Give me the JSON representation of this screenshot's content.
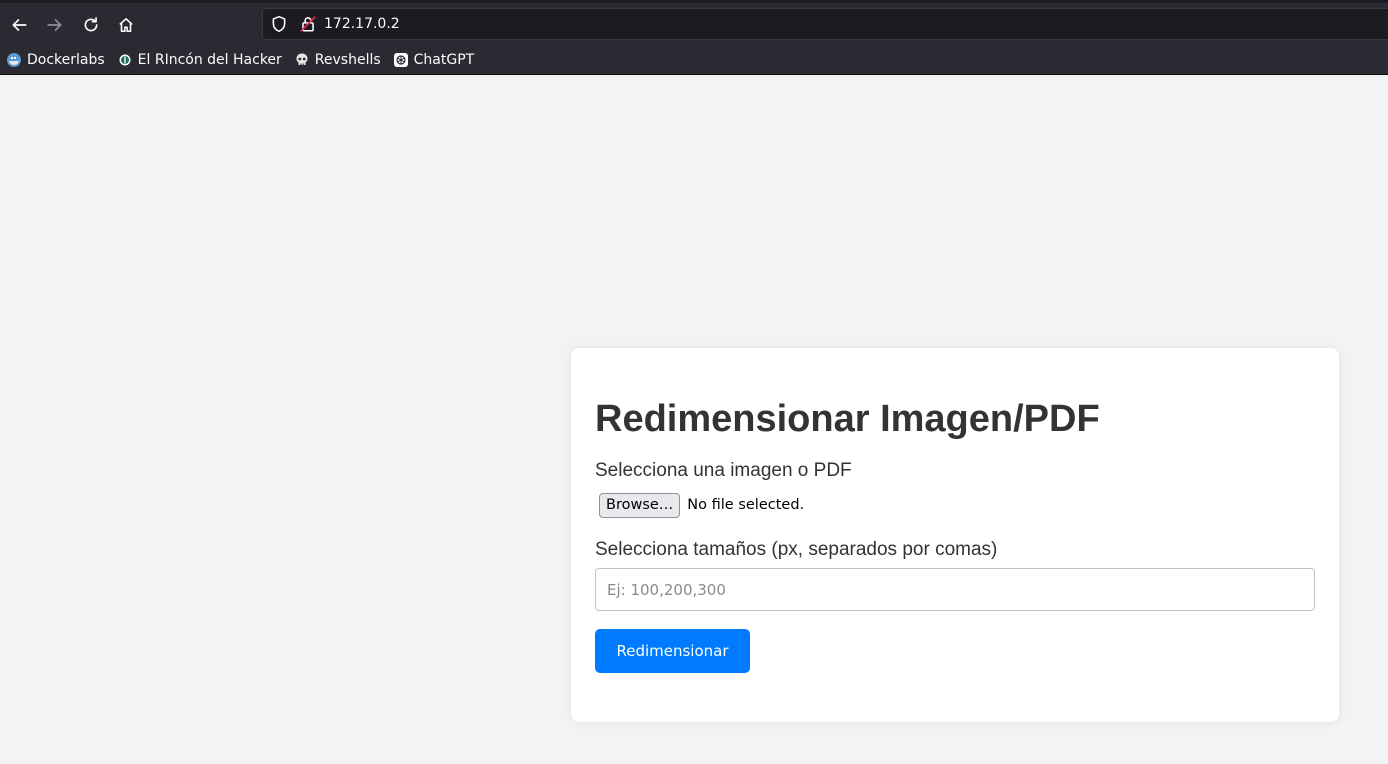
{
  "browser": {
    "url": "172.17.0.2",
    "nav": {
      "back_icon": "arrow-left-icon",
      "forward_icon": "arrow-right-icon",
      "reload_icon": "reload-icon",
      "home_icon": "home-icon"
    },
    "bookmarks": [
      {
        "label": "Dockerlabs",
        "icon": "dockerlabs-favicon"
      },
      {
        "label": "El RIncón del Hacker",
        "icon": "rincon-favicon"
      },
      {
        "label": "Revshells",
        "icon": "skull-favicon"
      },
      {
        "label": "ChatGPT",
        "icon": "chatgpt-favicon"
      }
    ]
  },
  "page": {
    "title": "Redimensionar Imagen/PDF",
    "file_label": "Selecciona una imagen o PDF",
    "browse_label": "Browse…",
    "file_status": "No file selected.",
    "sizes_label": "Selecciona tamaños (px, separados por comas)",
    "sizes_placeholder": "Ej: 100,200,300",
    "sizes_value": "",
    "submit_label": "Redimensionar"
  },
  "colors": {
    "page_bg": "#f3f3f3",
    "card_bg": "#ffffff",
    "accent": "#007bff",
    "chrome_bg": "#2b2a33",
    "text": "#333333"
  }
}
